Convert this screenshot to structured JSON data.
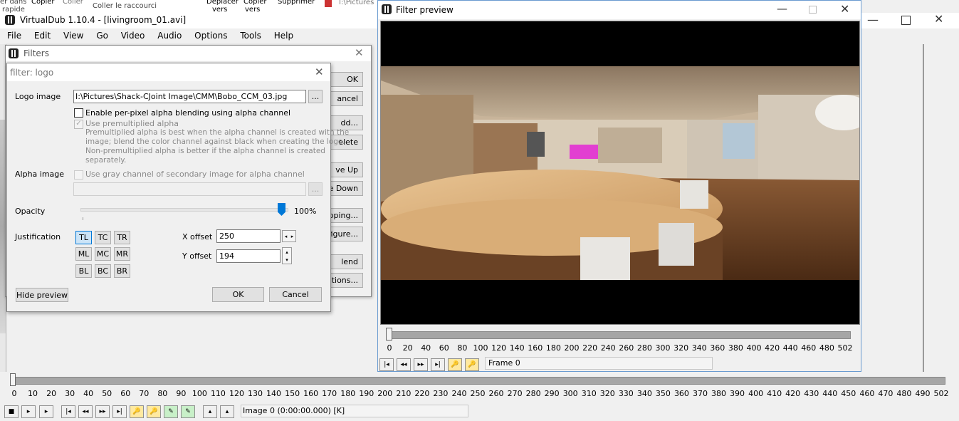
{
  "explorer": {
    "item1": "er dans",
    "item1b": "rapide",
    "item2": "Copier",
    "item3": "Coller",
    "item4": "Coller le raccourci",
    "item5": "Déplacer",
    "item5b": "vers",
    "item6": "Copier",
    "item6b": "vers",
    "item7": "Supprimer",
    "item8": "I:\\Pictures"
  },
  "main": {
    "title": "VirtualDub 1.10.4 - [livingroom_01.avi]",
    "menu": [
      "File",
      "Edit",
      "View",
      "Go",
      "Video",
      "Audio",
      "Options",
      "Tools",
      "Help"
    ],
    "scale": [
      "0",
      "10",
      "20",
      "30",
      "40",
      "50",
      "60",
      "70",
      "80",
      "90",
      "100",
      "110",
      "120",
      "130",
      "140",
      "150",
      "160",
      "170",
      "180",
      "190",
      "200",
      "210",
      "220",
      "230",
      "240",
      "250",
      "260",
      "270",
      "280",
      "290",
      "300",
      "310",
      "320",
      "330",
      "340",
      "350",
      "360",
      "370",
      "380",
      "390",
      "400",
      "410",
      "420",
      "430",
      "440",
      "450",
      "460",
      "470",
      "480",
      "490",
      "502"
    ],
    "status": "Image 0 (0:00:00.000) [K]"
  },
  "filters": {
    "title": "Filters",
    "buttons": [
      "OK",
      "ancel",
      "dd...",
      "elete",
      "ve Up",
      "e Down",
      "pping...",
      "figure...",
      "lend",
      "tions..."
    ]
  },
  "logo": {
    "title": "filter: logo",
    "logo_image_label": "Logo image",
    "logo_path": "I:\\Pictures\\Shack-CJoint Image\\CMM\\Bobo_CCM_03.jpg",
    "browse": "...",
    "enable_alpha": "Enable per-pixel alpha blending using alpha channel",
    "premult_label": "Use premultiplied alpha",
    "premult_desc1": "Premultiplied alpha is best when the alpha channel is created with the",
    "premult_desc2": "image; blend the color channel against black when creating the logo.",
    "premult_desc3": "Non-premultiplied alpha is better if the alpha channel is created",
    "premult_desc4": "separately.",
    "alpha_image_label": "Alpha image",
    "alpha_check_label": "Use gray channel of secondary image for alpha channel",
    "opacity_label": "Opacity",
    "opacity_value": "100%",
    "opacity_fraction": 1.0,
    "justification_label": "Justification",
    "just": [
      "TL",
      "TC",
      "TR",
      "ML",
      "MC",
      "MR",
      "BL",
      "BC",
      "BR"
    ],
    "x_offset_label": "X offset",
    "x_offset": "250",
    "y_offset_label": "Y offset",
    "y_offset": "194",
    "hide_preview": "Hide preview",
    "ok": "OK",
    "cancel": "Cancel"
  },
  "preview": {
    "title": "Filter preview",
    "scale": [
      "0",
      "20",
      "40",
      "60",
      "80",
      "100",
      "120",
      "140",
      "160",
      "180",
      "200",
      "220",
      "240",
      "260",
      "280",
      "300",
      "320",
      "340",
      "360",
      "380",
      "400",
      "420",
      "440",
      "460",
      "480",
      "502"
    ],
    "frame": "Frame 0"
  }
}
